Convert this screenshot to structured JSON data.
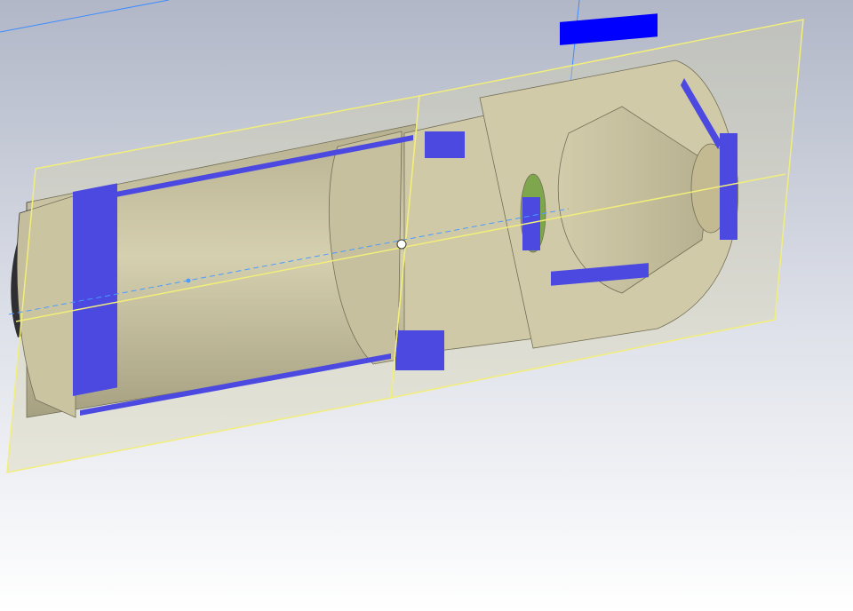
{
  "app": {
    "view": "section-view",
    "background_top": "#b4bac9",
    "background_bottom": "#ffffff"
  },
  "colors": {
    "section_face": "#0000ff",
    "part_body": "#c9c2a0",
    "part_dark": "#8e8a72",
    "part_light": "#ddd8be",
    "section_plane": "#d8d2a6",
    "plane_border": "#f2ee7a",
    "sketch_line": "#3d8cff",
    "axis_line": "#4a9cff",
    "edge": "#3c3a2c",
    "lens_green": "#4d8f1e"
  },
  "model": {
    "type": "cylindrical-assembly",
    "section_cut": true
  }
}
